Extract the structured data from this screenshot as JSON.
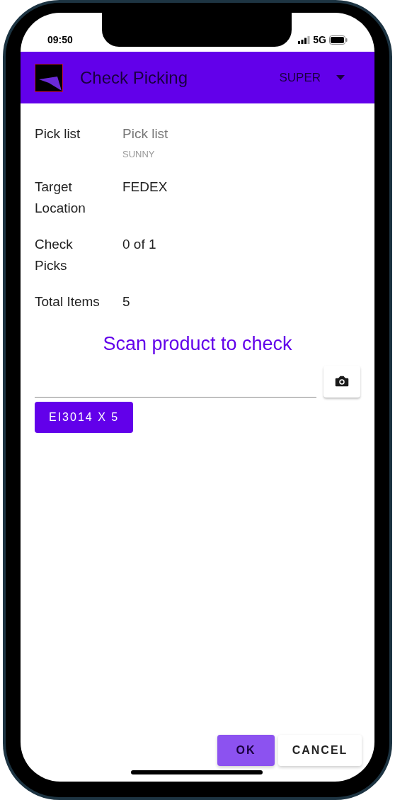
{
  "status_bar": {
    "time": "09:50",
    "network": "5G"
  },
  "app_bar": {
    "title": "Check Picking",
    "user": "SUPER"
  },
  "details": [
    {
      "label": "Pick list",
      "value": "Pick list",
      "muted": true,
      "note": "SUNNY"
    },
    {
      "label": "Target Location",
      "value": "FEDEX",
      "muted": false
    },
    {
      "label": "Check Picks",
      "value": "0 of 1",
      "muted": false
    },
    {
      "label": "Total Items",
      "value": "5",
      "muted": false
    }
  ],
  "prompt": "Scan product to check",
  "chips": [
    "EI3014 X 5"
  ],
  "buttons": [
    {
      "label": "OK",
      "kind": "primary"
    },
    {
      "label": "CANCEL",
      "kind": "secondary"
    }
  ]
}
